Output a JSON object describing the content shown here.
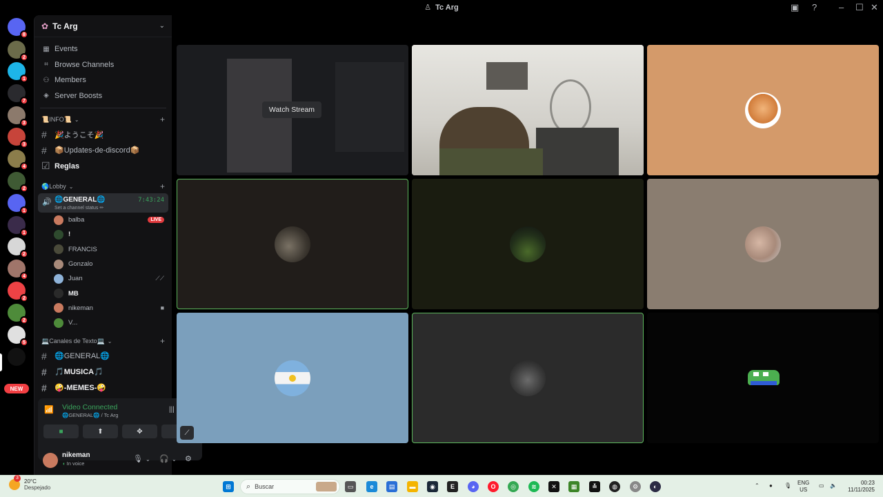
{
  "window": {
    "title": "Tc Arg"
  },
  "rail": {
    "new_label": "NEW",
    "servers": [
      {
        "name": "discord-home",
        "badge": "8",
        "color": "#5865f2"
      },
      {
        "name": "server-2",
        "badge": "2",
        "color": "#6b6b4a"
      },
      {
        "name": "server-3",
        "badge": "1",
        "color": "#1db5e8"
      },
      {
        "name": "server-4",
        "badge": "7",
        "color": "#2a2a2e"
      },
      {
        "name": "server-5",
        "badge": "3",
        "color": "#8c7a6c"
      },
      {
        "name": "server-6",
        "badge": "3",
        "color": "#c7443a"
      },
      {
        "name": "server-7",
        "badge": "4",
        "color": "#8b7d4b"
      },
      {
        "name": "server-8",
        "badge": "2",
        "color": "#3f5a34"
      },
      {
        "name": "server-9",
        "badge": "1",
        "color": "#5865f2"
      },
      {
        "name": "server-10",
        "badge": "1",
        "color": "#3a2b4a"
      },
      {
        "name": "server-11",
        "badge": "2",
        "color": "#d7d7d7"
      },
      {
        "name": "server-12",
        "badge": "4",
        "color": "#a0756a"
      },
      {
        "name": "server-13",
        "badge": "2",
        "color": "#ed4245"
      },
      {
        "name": "server-14",
        "badge": "2",
        "color": "#4e8b3a"
      },
      {
        "name": "server-15",
        "badge": "5",
        "color": "#e0e0e0"
      },
      {
        "name": "server-16",
        "badge": "",
        "color": "#111111"
      }
    ]
  },
  "sidebar": {
    "guild_name": "Tc Arg",
    "menu": [
      {
        "label": "Events",
        "icon": "calendar-icon"
      },
      {
        "label": "Browse Channels",
        "icon": "browse-icon"
      },
      {
        "label": "Members",
        "icon": "members-icon"
      },
      {
        "label": "Server Boosts",
        "icon": "boost-icon"
      }
    ],
    "cat_info": "📜INFO📜",
    "info_channels": [
      "🎉ようこそ🎉",
      "📦Updates-de-discord📦",
      "Reglas"
    ],
    "cat_lobby": "🌎Lobby",
    "voice": {
      "name": "🌐GENERAL🌐",
      "time": "7:43:24",
      "status": "Set a channel status ✏"
    },
    "voice_users": [
      {
        "name": "balba",
        "bold": false,
        "live": "LIVE",
        "color": "#c97a5f"
      },
      {
        "name": "!",
        "bold": true,
        "live": "",
        "color": "#2e4a2e"
      },
      {
        "name": "FRANCIS",
        "bold": false,
        "live": "",
        "color": "#4a4a3a"
      },
      {
        "name": "Gonzalo",
        "bold": false,
        "live": "",
        "color": "#a88a7a"
      },
      {
        "name": "Juan",
        "bold": false,
        "live": "",
        "color": "#8fb3d9"
      },
      {
        "name": "MB",
        "bold": true,
        "live": "",
        "color": "#2a2a2a"
      },
      {
        "name": "nikeman",
        "bold": false,
        "live": "",
        "color": "#c97a5f"
      },
      {
        "name": "V...",
        "bold": false,
        "live": "",
        "color": "#4e8b3a"
      }
    ],
    "cat_text": "💻Canales de Texto💻",
    "text_channels": [
      "🌐GENERAL🌐",
      "🎵MUSICA🎵",
      "🤪-MEMES-🤪"
    ]
  },
  "rtc": {
    "status": "Video Connected",
    "channel": "🌐GENERAL🌐 / Tc Arg"
  },
  "user": {
    "name": "nikeman",
    "status": "In voice"
  },
  "grid": {
    "watch_label": "Watch Stream",
    "tiles": [
      {
        "name": "stream-tile",
        "bg": "#1b1c1f"
      },
      {
        "name": "camera-tile",
        "bg": "#d8d5cf"
      },
      {
        "name": "tile-orange",
        "bg": "#d49a6a"
      },
      {
        "name": "tile-francis",
        "bg": "#211d1a"
      },
      {
        "name": "tile-dark-green",
        "bg": "#1a1c10"
      },
      {
        "name": "tile-gonzalo",
        "bg": "#8a7d70"
      },
      {
        "name": "tile-juan",
        "bg": "#7b9fbc"
      },
      {
        "name": "tile-grey",
        "bg": "#2b2b2b"
      },
      {
        "name": "tile-pepe",
        "bg": "#050505"
      }
    ]
  },
  "taskbar": {
    "temp": "20°C",
    "weather": "Despejado",
    "search": "Buscar",
    "lang1": "ENG",
    "lang2": "US",
    "time": "00:23",
    "date": "11/11/2025"
  }
}
